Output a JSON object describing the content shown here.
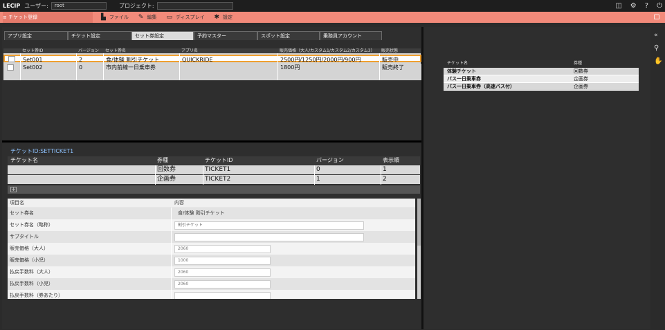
{
  "topbar": {
    "brand": "LECIP",
    "user_label": "ユーザー:",
    "user_value": "root",
    "project_label": "プロジェクト:",
    "project_value": "",
    "icons": [
      "panel-icon",
      "gear-icon",
      "help-icon",
      "logout-icon"
    ]
  },
  "menubar": {
    "title": "≡ チケット登録",
    "items": [
      {
        "icon": "file-icon",
        "label": "ファイル"
      },
      {
        "icon": "edit-icon",
        "label": "編集"
      },
      {
        "icon": "display-icon",
        "label": "ディスプレイ"
      },
      {
        "icon": "settings-icon",
        "label": "設定"
      }
    ]
  },
  "tabs": [
    "アプリ設定",
    "チケット設定",
    "セット券設定",
    "予約マスター",
    "スポット設定",
    "乗務員アカウント"
  ],
  "active_tab": "セット券設定",
  "set_grid": {
    "columns": [
      "セット券ID",
      "バージョン",
      "セット券名",
      "アプリ名",
      "販売価格（大人/カスタム1/カスタム2/カスタム3）",
      "販売状態"
    ],
    "rows": [
      {
        "id": "Set001",
        "version": "2",
        "name": "食/体験 割引チケット",
        "app": "QUICKRIDE",
        "price": "2500円/1250円/2000円/900円",
        "status": "販売中"
      },
      {
        "id": "Set002",
        "version": "0",
        "name": "市内前線一日乗車券",
        "app": "",
        "price": "1800円",
        "status": "販売終了"
      }
    ]
  },
  "ticket_section": {
    "title": "チケットID:SETTICKET1",
    "columns": [
      "チケット名",
      "券種",
      "チケットID",
      "バージョン",
      "表示順"
    ],
    "rows": [
      {
        "name": "",
        "type": "回数券",
        "ticket_id": "TICKET1",
        "version": "0",
        "order": "1"
      },
      {
        "name": "",
        "type": "企画券",
        "ticket_id": "TICKET2",
        "version": "1",
        "order": "2"
      }
    ],
    "add_label": "+"
  },
  "detail_form": {
    "col_item": "項目名",
    "col_content": "内容",
    "fields": [
      {
        "label": "セット券名",
        "value": "食/体験 割引チケット"
      },
      {
        "label": "セット券名（略称）",
        "value": "割引チケット"
      },
      {
        "label": "サブタイトル",
        "value": ""
      },
      {
        "label": "販売価格（大人）",
        "value": "2060"
      },
      {
        "label": "販売価格（小児）",
        "value": "1000"
      },
      {
        "label": "払戻手数料（大人）",
        "value": "2060"
      },
      {
        "label": "払戻手数料（小児）",
        "value": "2060"
      },
      {
        "label": "払戻手数料（券あたり）",
        "value": ""
      }
    ]
  },
  "right_grid": {
    "columns": [
      "チケット名",
      "券種"
    ],
    "rows": [
      {
        "name": "体験チケット",
        "type": "回数券"
      },
      {
        "name": "バス一日乗車券",
        "type": "企画券"
      },
      {
        "name": "バス一日乗車券（高速バス付）",
        "type": "企画券"
      }
    ]
  },
  "side_icons": [
    "collapse-icon",
    "search-icon",
    "hand-icon"
  ]
}
